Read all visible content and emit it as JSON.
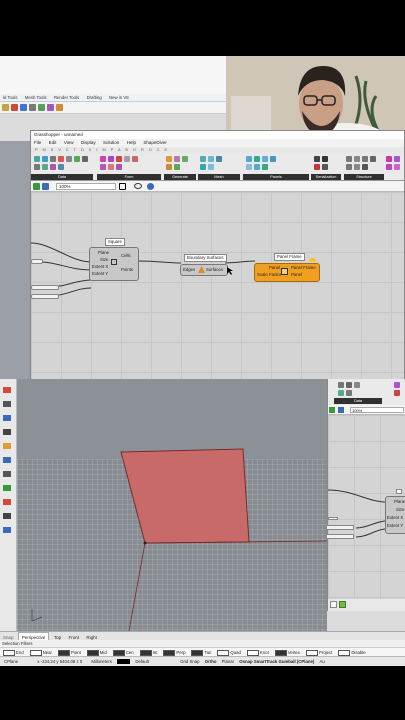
{
  "rhino": {
    "toolbar_tabs": [
      "ld Tools",
      "Mesh Tools",
      "Render Tools",
      "Drafting",
      "New in V8"
    ],
    "view_tabs": [
      "Perspective",
      "Top",
      "Front",
      "Right"
    ],
    "selection_filters": "Selection Filters",
    "osnaps": [
      "End",
      "Near",
      "Point",
      "Mid",
      "Cen",
      "Int",
      "Perp",
      "Tan",
      "Quad",
      "Knot",
      "Vertex",
      "Project",
      "Disable"
    ],
    "osnap_checked": [
      false,
      false,
      true,
      true,
      true,
      true,
      true,
      true,
      false,
      false,
      true,
      false,
      false
    ],
    "status": {
      "cplane": "CPlane",
      "coords": "x -234.24  y 5404.08  z 0",
      "units": "Millimeters",
      "layer": "Default",
      "grid_snap": "Grid Snap",
      "ortho": "Ortho",
      "planar": "Planar",
      "osnap": "Osnap",
      "smarttrack": "SmartTrack",
      "gumball": "Gumball (CPlane)",
      "more": "Au"
    },
    "left_tool_stub": "Snap",
    "surface_color": "#c96a6a"
  },
  "gh": {
    "title": "Grasshopper - unnamed",
    "menu": [
      "File",
      "Edit",
      "View",
      "Display",
      "Solution",
      "Help",
      "ShapeDiver"
    ],
    "tab_letters": "P M S V C T D X I M P A B O R O C E",
    "groups": [
      "Geometry",
      "Primitive",
      "Input",
      "Util",
      "Form",
      "Generate",
      "Mesh",
      "Panels",
      "Serialization",
      "Structure",
      "Data"
    ],
    "zoom": "100%",
    "nodes": {
      "square": {
        "title": "Square",
        "inputs": [
          "Plane",
          "Size",
          "Extent X",
          "Extent Y"
        ],
        "outputs": [
          "Cells",
          "Points"
        ]
      },
      "boundary": {
        "title": "Boundary Surfaces",
        "input": "Edges",
        "output": "Surfaces"
      },
      "panel": {
        "title": "Panel Frame",
        "inputs": [
          "Panel",
          "Scale Factor"
        ],
        "outputs": [
          "Panel Frame",
          "Panel"
        ]
      }
    }
  },
  "gh2": {
    "group": "Data",
    "zoom": "100%",
    "inputs": [
      "Plane",
      "Size",
      "Extent X",
      "Extent Y"
    ]
  },
  "colors": {
    "panel_node": "#f0a020",
    "accent_green": "#3a9a3a"
  }
}
